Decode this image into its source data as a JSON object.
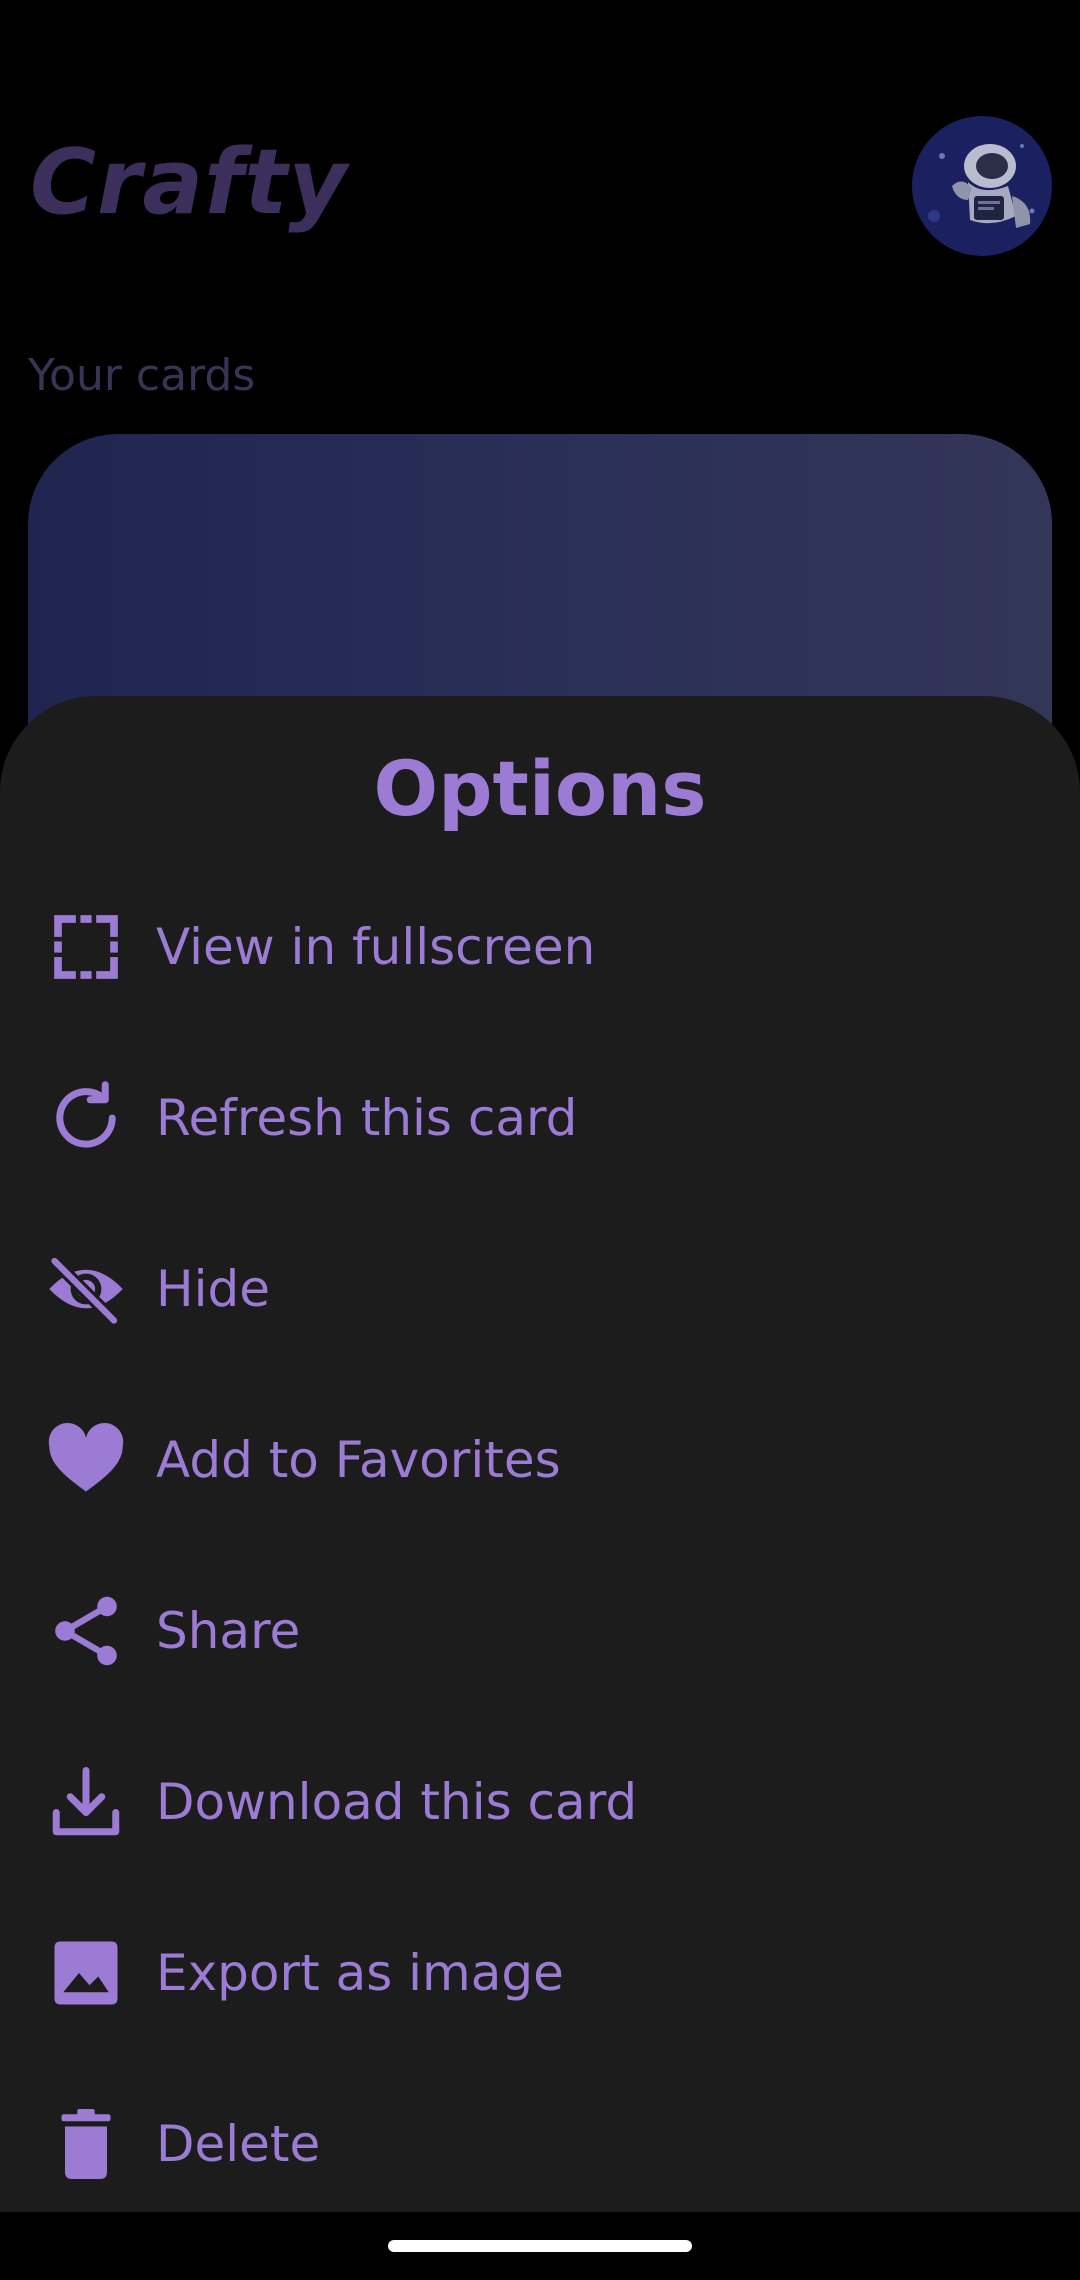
{
  "app": {
    "title": "Crafty",
    "section_label": "Your cards"
  },
  "sheet": {
    "title": "Options",
    "options": [
      {
        "label": "View in fullscreen",
        "icon": "fullscreen-icon"
      },
      {
        "label": "Refresh this card",
        "icon": "refresh-icon"
      },
      {
        "label": "Hide",
        "icon": "eye-off-icon"
      },
      {
        "label": "Add to Favorites",
        "icon": "heart-icon"
      },
      {
        "label": "Share",
        "icon": "share-icon"
      },
      {
        "label": "Download this card",
        "icon": "download-icon"
      },
      {
        "label": "Export as image",
        "icon": "image-icon"
      },
      {
        "label": "Delete",
        "icon": "trash-icon"
      }
    ]
  },
  "colors": {
    "accent": "#9b7bd3",
    "sheet_background": "#1c1c1d",
    "dim_title": "#3c2f5c"
  }
}
